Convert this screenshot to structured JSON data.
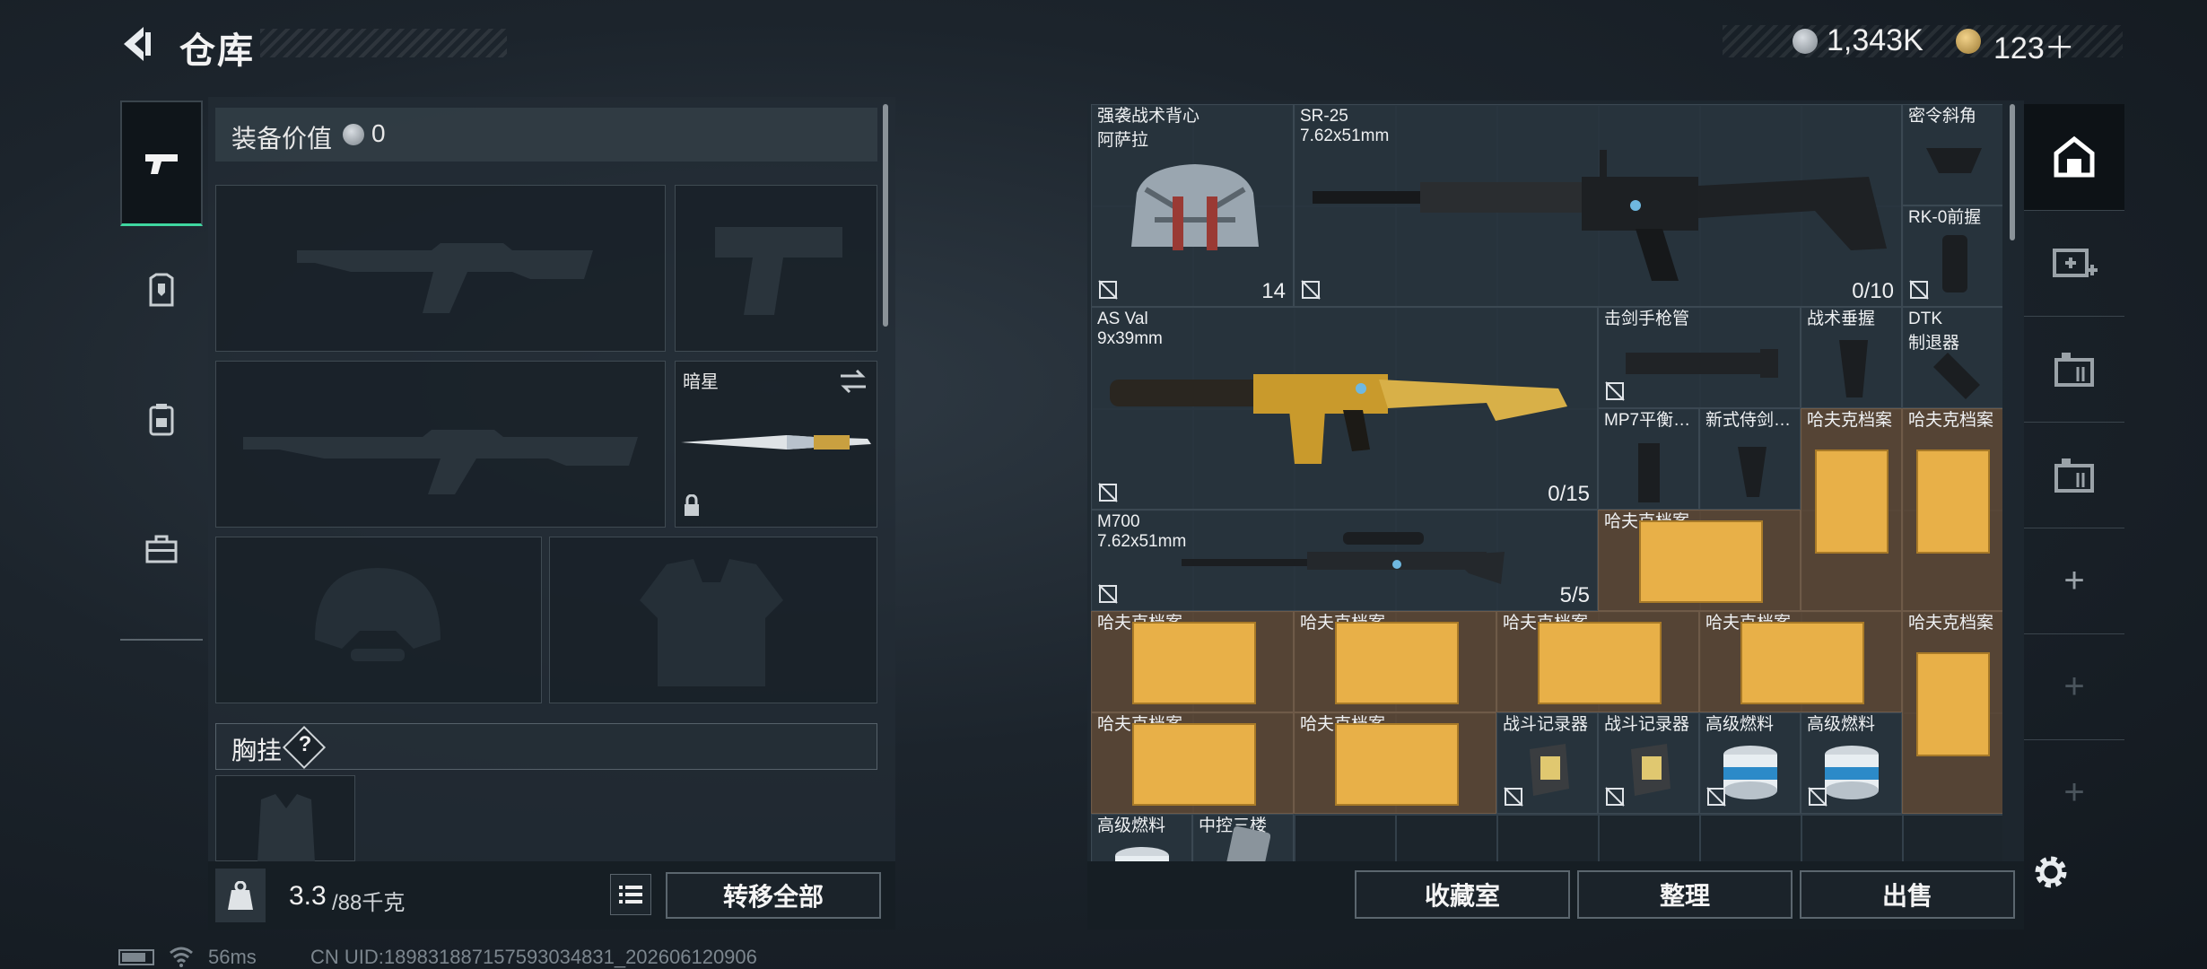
{
  "header": {
    "title": "仓库"
  },
  "currency": {
    "silver": "1,343K",
    "gold": "123＋"
  },
  "loadout": {
    "equip_value_label": "装备价值",
    "equip_value": "0",
    "melee_name": "暗星",
    "chest_rig_label": "胸挂",
    "chest_help": "?",
    "weight_current": "3.3",
    "weight_max": "/88千克",
    "transfer_all": "转移全部"
  },
  "storage": {
    "items": [
      {
        "name": "强袭战术背心",
        "sub": "阿萨拉",
        "count": "14",
        "icon": "backpack-icon"
      },
      {
        "name": "SR-25",
        "sub": "7.62x51mm",
        "count": "0/10",
        "icon": "rifle-icon"
      },
      {
        "name": "密令斜角",
        "sub": "",
        "count": "",
        "icon": "grip-icon"
      },
      {
        "name": "RK-0前握",
        "sub": "",
        "count": "",
        "icon": "grip-icon"
      },
      {
        "name": "AS Val",
        "sub": "9x39mm",
        "count": "0/15",
        "icon": "rifle-icon"
      },
      {
        "name": "击剑手枪管",
        "sub": "",
        "count": "",
        "icon": "barrel-icon"
      },
      {
        "name": "战术垂握",
        "sub": "",
        "count": "",
        "icon": "grip-icon"
      },
      {
        "name": "DTK",
        "sub": "制退器",
        "count": "",
        "icon": "muzzle-icon"
      },
      {
        "name": "MP7平衡…",
        "sub": "",
        "count": "",
        "icon": "mag-icon"
      },
      {
        "name": "新式侍剑…",
        "sub": "",
        "count": "",
        "icon": "grip-icon"
      },
      {
        "name": "哈夫克档案",
        "sub": "",
        "count": "",
        "icon": "file-icon"
      },
      {
        "name": "M700",
        "sub": "7.62x51mm",
        "count": "5/5",
        "icon": "sniper-icon"
      },
      {
        "name": "战斗记录器",
        "sub": "",
        "count": "",
        "icon": "recorder-icon"
      },
      {
        "name": "高级燃料",
        "sub": "",
        "count": "",
        "icon": "fuel-icon"
      },
      {
        "name": "中控三楼",
        "sub": "",
        "count": "",
        "icon": "keycard-icon"
      }
    ],
    "btn_collect": "收藏室",
    "btn_sort": "整理",
    "btn_sell": "出售"
  },
  "status": {
    "ping": "56ms",
    "uid": "CN UID:1898318871575930348​31_202606120906"
  }
}
